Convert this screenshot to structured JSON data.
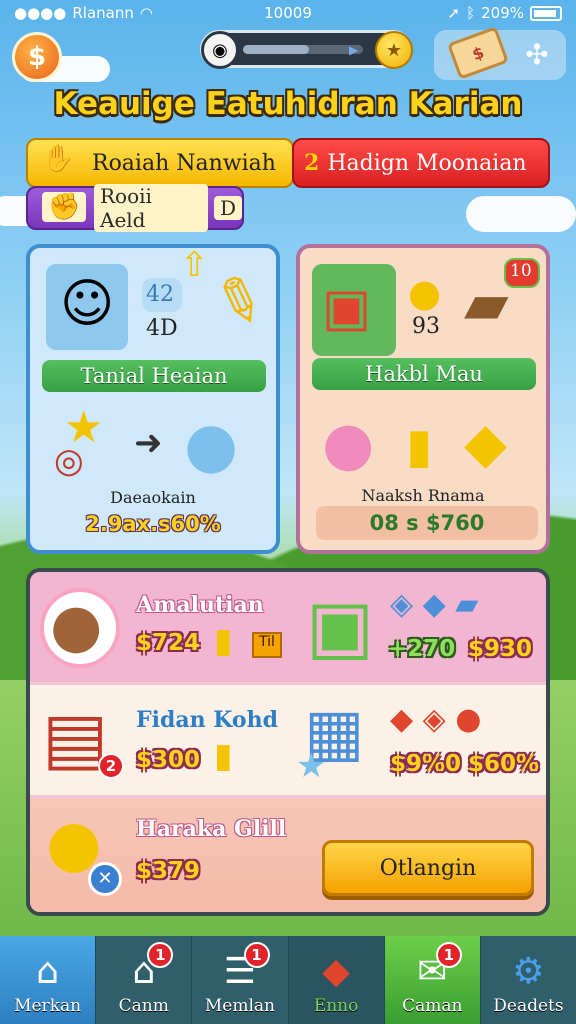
{
  "status_bar": {
    "carrier": "Rlanann",
    "time": "10009",
    "battery": "209%"
  },
  "hud": {
    "coin_symbol": "$",
    "progress": 0.55,
    "star_symbol": "★",
    "ticket_symbol": "$"
  },
  "title": "Keauige Eatuhidran Karian",
  "banners": {
    "yellow": "Roaiah Nanwiah",
    "red_number": "2",
    "red": "Hadign Moonaian",
    "purple": "Rooii Aeld",
    "purple_tag": "D"
  },
  "left_panel": {
    "stat_top": "42",
    "stat_bottom": "4D",
    "label": "Tanial Heaian",
    "caption": "Daeaokain",
    "percent": "2.9ax.s60%"
  },
  "right_panel": {
    "corner_badge": "10",
    "stat": "93",
    "label": "Hakbl Mau",
    "caption": "Naaksh Rnama",
    "value": "08 s $760"
  },
  "shop": {
    "rows": [
      {
        "name": "Amalutian",
        "price": "$724",
        "tag": "Til",
        "price_b": "+270",
        "price_c": "$930"
      },
      {
        "name": "Fidan Kohd",
        "price": "$300",
        "badge": "2",
        "price_b": "$9%0",
        "price_c": "$60%"
      },
      {
        "name": "Haraka Glill",
        "price": "$379",
        "button": "Otlangin"
      }
    ]
  },
  "nav": [
    {
      "label": "Merkan",
      "icon": "home-icon"
    },
    {
      "label": "Canm",
      "icon": "house-icon",
      "badge": "1"
    },
    {
      "label": "Memlan",
      "icon": "list-icon",
      "badge": "1"
    },
    {
      "label": "Enno",
      "icon": "box-icon"
    },
    {
      "label": "Caman",
      "icon": "chat-icon",
      "badge": "1"
    },
    {
      "label": "Deadets",
      "icon": "gear-icon"
    }
  ]
}
